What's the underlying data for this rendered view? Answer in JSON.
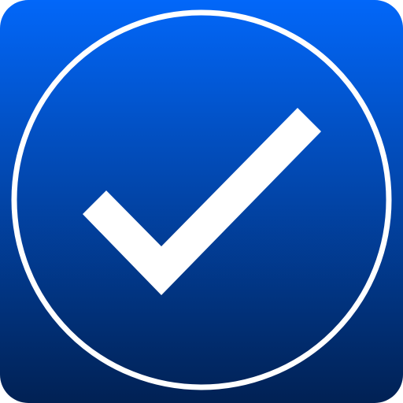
{
  "icon": {
    "name": "checkmark-icon",
    "colors": {
      "gradient_top": "#0267f9",
      "gradient_bottom": "#012154",
      "ring": "#ffffff",
      "check": "#ffffff"
    }
  }
}
